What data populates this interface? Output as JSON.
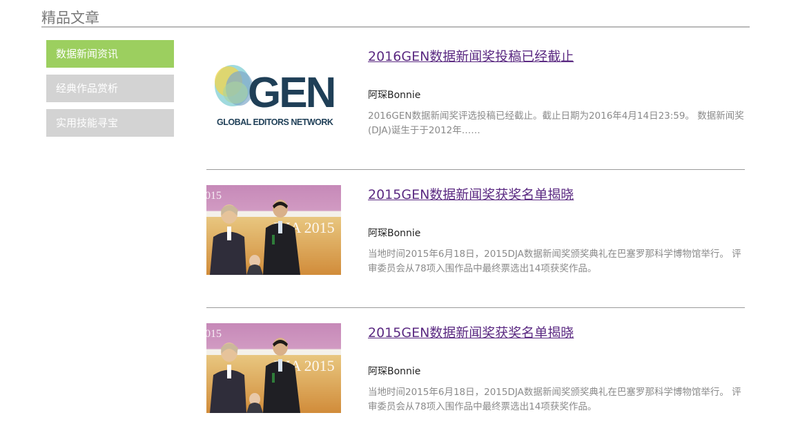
{
  "page": {
    "title": "精品文章"
  },
  "sidebar": {
    "items": [
      {
        "label": "数据新闻资讯",
        "active": true
      },
      {
        "label": "经典作品赏析",
        "active": false
      },
      {
        "label": "实用技能寻宝",
        "active": false
      }
    ]
  },
  "articles": [
    {
      "title": "2016GEN数据新闻奖投稿已经截止",
      "author": "阿琛Bonnie",
      "summary": "2016GEN数据新闻奖评选投稿已经截止。截止日期为2016年4月14日23:59。 数据新闻奖(DJA)诞生于于2012年……",
      "image": {
        "type": "gen-logo",
        "logo_text": "GEN",
        "logo_subtext": "GLOBAL EDITORS NETWORK"
      }
    },
    {
      "title": "2015GEN数据新闻奖获奖名单揭晓",
      "author": "阿琛Bonnie",
      "summary": "当地时间2015年6月18日，2015DJA数据新闻奖颁奖典礼在巴塞罗那科学博物馆举行。 评审委员会从78项入围作品中最终票选出14项获奖作品。",
      "image": {
        "type": "award-photo",
        "screen_text": "DJA 2015",
        "corner_text": "015"
      }
    },
    {
      "title": "2015GEN数据新闻奖获奖名单揭晓",
      "author": "阿琛Bonnie",
      "summary": "当地时间2015年6月18日，2015DJA数据新闻奖颁奖典礼在巴塞罗那科学博物馆举行。 评审委员会从78项入围作品中最终票选出14项获奖作品。",
      "image": {
        "type": "award-photo",
        "screen_text": "DJA 2015",
        "corner_text": "015"
      }
    }
  ],
  "colors": {
    "accent_green": "#9ccf5f",
    "inactive_gray": "#d3d3d3",
    "link_purple": "#5b2a82"
  }
}
